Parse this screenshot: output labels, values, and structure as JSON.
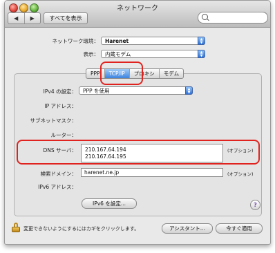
{
  "window": {
    "title": "ネットワーク",
    "nav_back": "◀",
    "nav_forward": "▶",
    "show_all": "すべてを表示",
    "search_placeholder": ""
  },
  "location": {
    "label": "ネットワーク環境：",
    "value": "Harenet"
  },
  "show": {
    "label": "表示：",
    "value": "内蔵モデム"
  },
  "tabs": [
    {
      "label": "PPP"
    },
    {
      "label": "TCP/IP",
      "selected": true
    },
    {
      "label": "プロキシ"
    },
    {
      "label": "モデム"
    }
  ],
  "ipv4": {
    "label": "IPv4 の設定：",
    "value": "PPP を使用"
  },
  "ip_address": {
    "label": "IP アドレス："
  },
  "subnet_mask": {
    "label": "サブネットマスク："
  },
  "router": {
    "label": "ルーター："
  },
  "dns": {
    "label": "DNS サーバ：",
    "servers": [
      "210.167.64.194",
      "210.167.64.195"
    ],
    "optional": "(オプション)"
  },
  "search_domain": {
    "label": "検索ドメイン：",
    "value": "harenet.ne.jp",
    "optional": "(オプション)"
  },
  "ipv6_address": {
    "label": "IPv6 アドレス："
  },
  "buttons": {
    "ipv6_setup": "IPv6 を設定...",
    "help": "?",
    "assistant": "アシスタント...",
    "apply_now": "今すぐ適用"
  },
  "lock_text": "変更できないようにするにはカギをクリックします。",
  "colors": {
    "highlight_box": "#e0231f",
    "selected_tab": "#3c84e0"
  }
}
